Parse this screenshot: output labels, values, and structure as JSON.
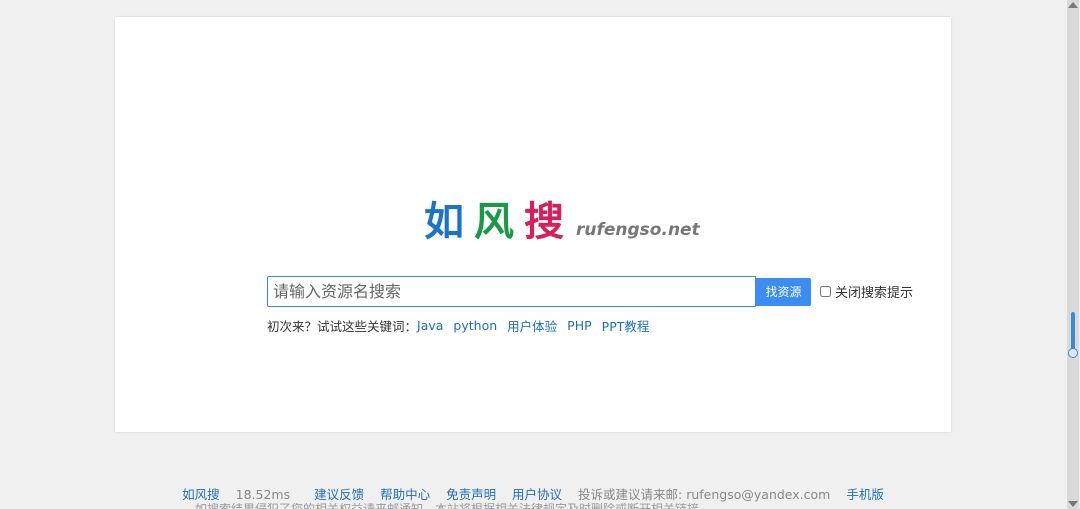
{
  "logo": {
    "chars": [
      {
        "text": "如",
        "color": "#1b74c9"
      },
      {
        "text": "风",
        "color": "#1a9a47"
      },
      {
        "text": "搜",
        "color": "#d81e5b"
      }
    ],
    "domain": "rufengso.net"
  },
  "search": {
    "placeholder": "请输入资源名搜索",
    "value": "",
    "button_label": "找资源",
    "toggle_label": "关闭搜索提示",
    "toggle_checked": false
  },
  "suggest": {
    "prompt": "初次来？试试这些关键词：",
    "keywords": [
      "Java",
      "python",
      "用户体验",
      "PHP",
      "PPT教程"
    ]
  },
  "footer": {
    "site_name": "如风搜",
    "timing": "18.52ms",
    "links": [
      "建议反馈",
      "帮助中心",
      "免责声明",
      "用户协议"
    ],
    "contact": "投诉或建议请来邮: rufengso@yandex.com",
    "mobile": "手机版",
    "second_line": "如搜索结果侵犯了您的相关权益请来邮通知，本站将根据相关法律规定及时删除或断开相关链接"
  },
  "colors": {
    "accent": "#3b8df4",
    "link": "#1f6fb8",
    "input_border": "#3c8dd8",
    "background": "#f0f0f0"
  }
}
